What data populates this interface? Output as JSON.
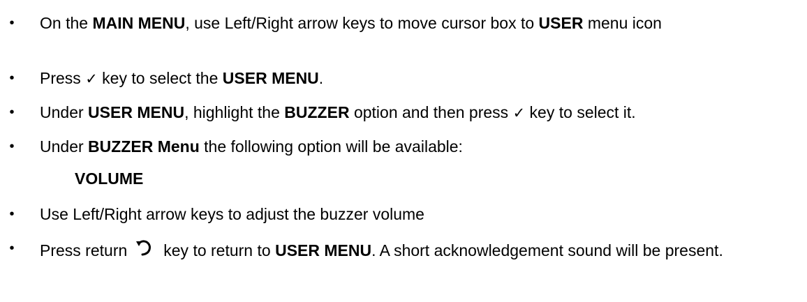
{
  "bullet_char": "•",
  "check_char": "✓",
  "items": [
    {
      "a": "On the ",
      "b": "MAIN MENU",
      "c": ", use Left/Right arrow keys to move cursor box to ",
      "d": "USER",
      "e": " menu icon"
    },
    {
      "a": "Press ",
      "c": " key to select the ",
      "d": "USER MENU",
      "e": "."
    },
    {
      "a": "Under ",
      "b": "USER MENU",
      "c": ", highlight the ",
      "d": "BUZZER",
      "e": " option and then press ",
      "g": " key to select it."
    },
    {
      "a": "Under ",
      "b": "BUZZER Menu",
      "c": " the following option will be available:"
    },
    {
      "a": "Use Left/Right arrow keys to adjust the buzzer volume"
    },
    {
      "a": "Press return",
      "c": "key to return to ",
      "d": "USER MENU",
      "e": ". A short acknowledgement sound will be present."
    }
  ],
  "volume_label": "VOLUME"
}
